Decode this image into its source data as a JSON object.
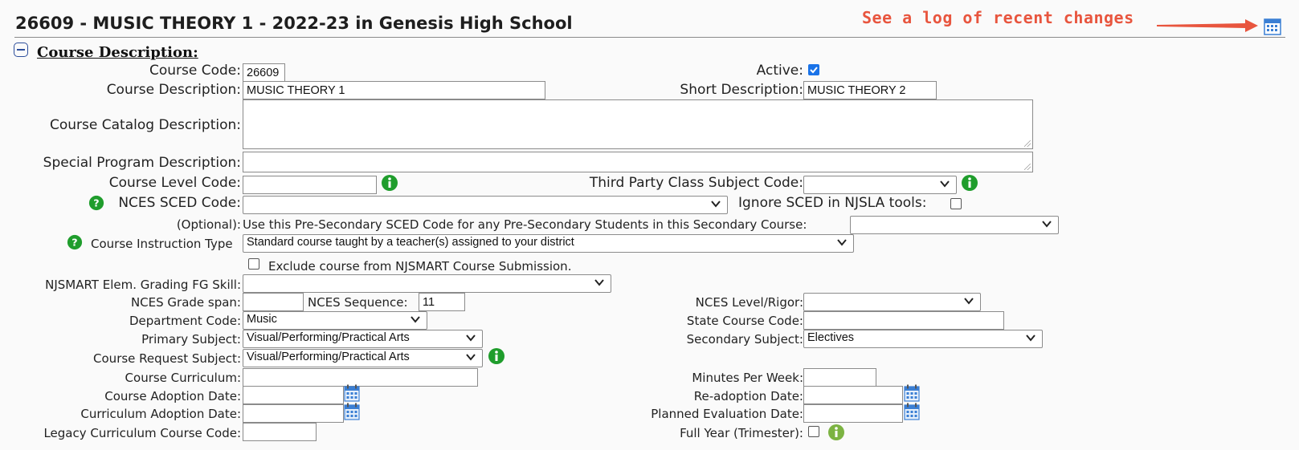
{
  "page": {
    "title": "26609 - MUSIC THEORY 1 - 2022-23 in Genesis High School",
    "annotation": "See a log of recent changes",
    "section_title": "Course Description:"
  },
  "colors": {
    "annotation": "#e8553e",
    "info_icon": "#1f9d2c",
    "checkbox_checked": "#1a73e8",
    "calendar_icon": "#3b7fd4"
  },
  "fields": {
    "course_code": {
      "label": "Course Code:",
      "value": "26609"
    },
    "active": {
      "label": "Active:",
      "checked": true
    },
    "course_description": {
      "label": "Course Description:",
      "value": "MUSIC THEORY 1"
    },
    "short_description": {
      "label": "Short Description:",
      "value": "MUSIC THEORY 2"
    },
    "catalog_description": {
      "label": "Course Catalog Description:",
      "value": ""
    },
    "special_program": {
      "label": "Special Program Description:",
      "value": ""
    },
    "course_level_code": {
      "label": "Course Level Code:",
      "value": ""
    },
    "third_party_subject": {
      "label": "Third Party Class Subject Code:",
      "value": ""
    },
    "nces_sced_code": {
      "label": "NCES SCED Code:",
      "value": ""
    },
    "ignore_sced": {
      "label": "Ignore SCED in NJSLA tools:",
      "checked": false
    },
    "optional_label": "(Optional):",
    "pre_secondary": {
      "label": "Use this Pre-Secondary SCED Code for any Pre-Secondary Students in this Secondary Course:",
      "value": ""
    },
    "instruction_type": {
      "label": "Course Instruction Type",
      "value": "Standard course taught by a teacher(s) assigned to your district"
    },
    "exclude_njsmart": {
      "label": "Exclude course from NJSMART Course Submission.",
      "checked": false
    },
    "njsmart_fg_skill": {
      "label": "NJSMART Elem. Grading FG Skill:",
      "value": ""
    },
    "nces_grade_span": {
      "label": "NCES Grade span:",
      "value": ""
    },
    "nces_sequence": {
      "label": "NCES Sequence:",
      "value": "11"
    },
    "nces_level_rigor": {
      "label": "NCES Level/Rigor:",
      "value": ""
    },
    "department_code": {
      "label": "Department Code:",
      "value": "Music"
    },
    "state_course_code": {
      "label": "State Course Code:",
      "value": ""
    },
    "primary_subject": {
      "label": "Primary Subject:",
      "value": "Visual/Performing/Practical Arts"
    },
    "secondary_subject": {
      "label": "Secondary Subject:",
      "value": "Electives"
    },
    "request_subject": {
      "label": "Course Request Subject:",
      "value": "Visual/Performing/Practical Arts"
    },
    "course_curriculum": {
      "label": "Course Curriculum:",
      "value": ""
    },
    "minutes_per_week": {
      "label": "Minutes Per Week:",
      "value": ""
    },
    "course_adoption_date": {
      "label": "Course Adoption Date:",
      "value": ""
    },
    "readoption_date": {
      "label": "Re-adoption Date:",
      "value": ""
    },
    "curriculum_adoption_date": {
      "label": "Curriculum Adoption Date:",
      "value": ""
    },
    "planned_eval_date": {
      "label": "Planned Evaluation Date:",
      "value": ""
    },
    "legacy_code": {
      "label": "Legacy Curriculum Course Code:",
      "value": ""
    },
    "full_year": {
      "label": "Full Year (Trimester):",
      "checked": false
    }
  }
}
